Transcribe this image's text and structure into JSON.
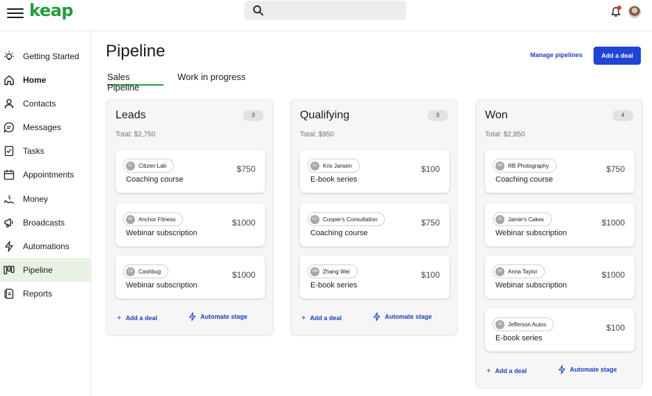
{
  "app": {
    "logo": "keap"
  },
  "search": {
    "placeholder": "",
    "value": ""
  },
  "colors": {
    "brand": "#1f9d3a",
    "primary": "#1f44d6",
    "link": "#1b3fbf",
    "notification": "#e23b2e"
  },
  "sidebar": {
    "items": [
      {
        "label": "Getting Started",
        "icon": "lightbulb-icon"
      },
      {
        "label": "Home",
        "icon": "home-icon"
      },
      {
        "label": "Contacts",
        "icon": "contacts-icon"
      },
      {
        "label": "Messages",
        "icon": "messages-icon"
      },
      {
        "label": "Tasks",
        "icon": "tasks-icon"
      },
      {
        "label": "Appointments",
        "icon": "calendar-icon"
      },
      {
        "label": "Money",
        "icon": "money-icon"
      },
      {
        "label": "Broadcasts",
        "icon": "broadcast-icon"
      },
      {
        "label": "Automations",
        "icon": "lightning-icon"
      },
      {
        "label": "Pipeline",
        "icon": "pipeline-icon"
      },
      {
        "label": "Reports",
        "icon": "reports-icon"
      }
    ]
  },
  "header": {
    "title": "Pipeline",
    "manage_label": "Manage pipelines",
    "add_deal_label": "Add a deal"
  },
  "tabs": [
    {
      "label": "Sales Pipeline",
      "active": true
    },
    {
      "label": "Work in progress",
      "active": false
    }
  ],
  "columns": [
    {
      "title": "Leads",
      "count": "3",
      "total": "Total: $2,750",
      "add_label": "Add a deal",
      "automate_label": "Automate stage",
      "deals": [
        {
          "initials": "CL",
          "contact": "Citizen Lab",
          "name": "Coaching course",
          "amount": "$750"
        },
        {
          "initials": "AF",
          "contact": "Anchor Fitness",
          "name": "Webinar subscription",
          "amount": "$1000"
        },
        {
          "initials": "CB",
          "contact": "Cashbug",
          "name": "Webinar subscription",
          "amount": "$1000"
        }
      ]
    },
    {
      "title": "Qualifying",
      "count": "3",
      "total": "Total: $950",
      "add_label": "Add a deal",
      "automate_label": "Automate stage",
      "deals": [
        {
          "initials": "KJ",
          "contact": "Kris Jansen",
          "name": "E-book series",
          "amount": "$100"
        },
        {
          "initials": "CC",
          "contact": "Cooper's Consultation",
          "name": "Coaching course",
          "amount": "$750"
        },
        {
          "initials": "ZW",
          "contact": "Zhang Wei",
          "name": "E-book series",
          "amount": "$100"
        }
      ]
    },
    {
      "title": "Won",
      "count": "4",
      "total": "Total: $2,850",
      "add_label": "Add a deal",
      "automate_label": "Automate stage",
      "deals": [
        {
          "initials": "RB",
          "contact": "RB Photography",
          "name": "Coaching course",
          "amount": "$750"
        },
        {
          "initials": "JC",
          "contact": "Jamie's Cakes",
          "name": "Webinar subscription",
          "amount": "$1000"
        },
        {
          "initials": "AT",
          "contact": "Anna Taylor",
          "name": "Webinar subscription",
          "amount": "$1000"
        },
        {
          "initials": "JA",
          "contact": "Jefferson Autos",
          "name": "E-book series",
          "amount": "$100"
        }
      ]
    }
  ]
}
